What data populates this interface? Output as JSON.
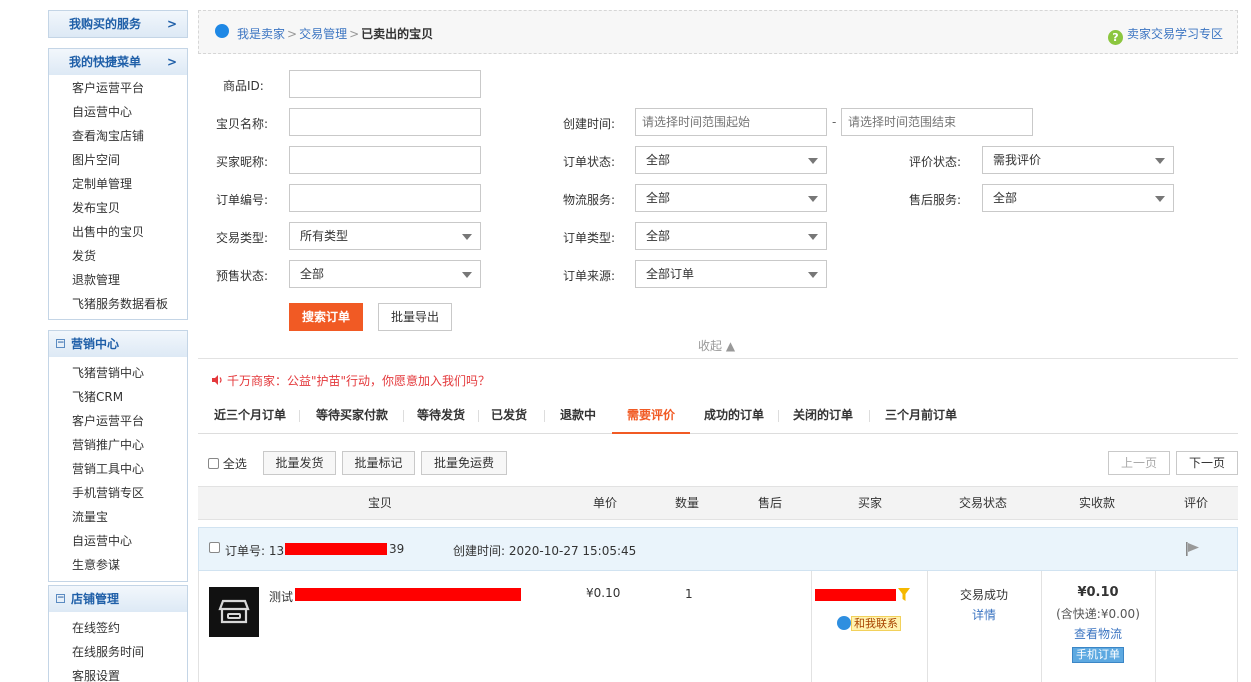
{
  "sidebar": {
    "box1": {
      "title": "我购买的服务",
      "arrow": ">"
    },
    "box2": {
      "title": "我的快捷菜单",
      "arrow": ">",
      "items": [
        "客户运营平台",
        "自运营中心",
        "查看淘宝店铺",
        "图片空间",
        "定制单管理",
        "发布宝贝",
        "出售中的宝贝",
        "发货",
        "退款管理",
        "飞猪服务数据看板"
      ]
    },
    "box3": {
      "title": "营销中心",
      "toggle": "−",
      "items": [
        "飞猪营销中心",
        "飞猪CRM",
        "客户运营平台",
        "营销推广中心",
        "营销工具中心",
        "手机营销专区",
        "流量宝",
        "自运营中心",
        "生意参谋"
      ]
    },
    "box4": {
      "title": "店铺管理",
      "toggle": "−",
      "items": [
        "在线签约",
        "在线服务时间",
        "客服设置"
      ]
    }
  },
  "breadcrumb": {
    "items": [
      "我是卖家",
      "交易管理"
    ],
    "separator": ">",
    "current": "已卖出的宝贝",
    "help_icon": "?",
    "help": "卖家交易学习专区"
  },
  "form": {
    "product_id_label": "商品ID:",
    "item_name_label": "宝贝名称:",
    "buyer_label": "买家昵称:",
    "order_no_label": "订单编号:",
    "trade_type_label": "交易类型:",
    "trade_type_value": "所有类型",
    "presale_label": "预售状态:",
    "presale_value": "全部",
    "created_label": "创建时间:",
    "created_start_placeholder": "请选择时间范围起始",
    "created_dash": "-",
    "created_end_placeholder": "请选择时间范围结束",
    "order_status_label": "订单状态:",
    "order_status_value": "全部",
    "logistics_label": "物流服务:",
    "logistics_value": "全部",
    "order_type_label": "订单类型:",
    "order_type_value": "全部",
    "order_source_label": "订单来源:",
    "order_source_value": "全部订单",
    "review_status_label": "评价状态:",
    "review_status_value": "需我评价",
    "aftersale_label": "售后服务:",
    "aftersale_value": "全部",
    "search_button": "搜索订单",
    "export_button": "批量导出",
    "collapse": "收起 ▲"
  },
  "notice": "千万商家：公益\"护苗\"行动，你愿意加入我们吗？",
  "tabs": [
    "近三个月订单",
    "等待买家付款",
    "等待发货",
    "已发货",
    "退款中",
    "需要评价",
    "成功的订单",
    "关闭的订单",
    "三个月前订单"
  ],
  "active_tab": "需要评价",
  "toolbar": {
    "select_all": "全选",
    "batch_ship": "批量发货",
    "batch_mark": "批量标记",
    "batch_free_ship": "批量免运费",
    "prev_page": "上一页",
    "next_page": "下一页"
  },
  "table": {
    "headers": [
      "宝贝",
      "单价",
      "数量",
      "售后",
      "买家",
      "交易状态",
      "实收款",
      "评价"
    ]
  },
  "order": {
    "order_no_label": "订单号: 13",
    "order_no_suffix": "39",
    "created_time": "创建时间: 2020-10-27 15:05:45",
    "item_title_prefix": "测试",
    "price": "¥0.10",
    "quantity": "1",
    "contact_button": "和我联系",
    "status": "交易成功",
    "details": "详情",
    "total": "¥0.10",
    "shipping": "(含快递:¥0.00)",
    "view_logistics": "查看物流",
    "mobile_order_badge": "手机订单"
  },
  "colors": {
    "accent": "#f15a24",
    "link": "#3c75c2",
    "notice": "#e4393c",
    "redaction": "#ff0000"
  }
}
